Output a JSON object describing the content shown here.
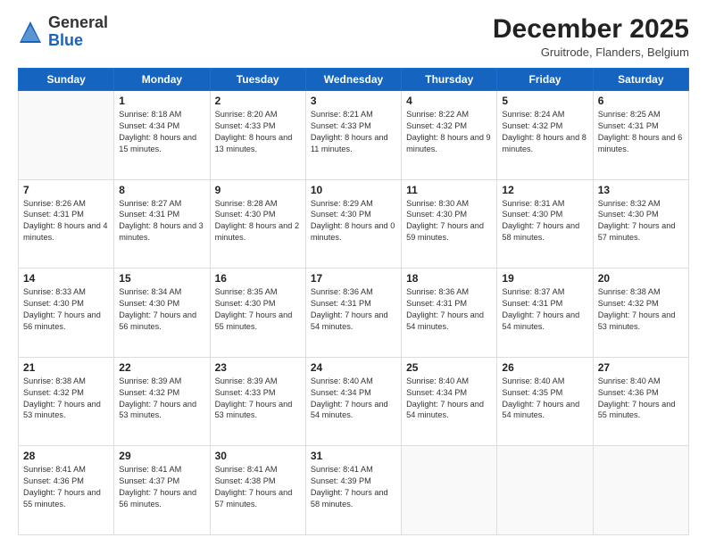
{
  "header": {
    "logo": {
      "general": "General",
      "blue": "Blue"
    },
    "title": "December 2025",
    "location": "Gruitrode, Flanders, Belgium"
  },
  "days_of_week": [
    "Sunday",
    "Monday",
    "Tuesday",
    "Wednesday",
    "Thursday",
    "Friday",
    "Saturday"
  ],
  "weeks": [
    [
      {
        "day": "",
        "info": ""
      },
      {
        "day": "1",
        "info": "Sunrise: 8:18 AM\nSunset: 4:34 PM\nDaylight: 8 hours\nand 15 minutes."
      },
      {
        "day": "2",
        "info": "Sunrise: 8:20 AM\nSunset: 4:33 PM\nDaylight: 8 hours\nand 13 minutes."
      },
      {
        "day": "3",
        "info": "Sunrise: 8:21 AM\nSunset: 4:33 PM\nDaylight: 8 hours\nand 11 minutes."
      },
      {
        "day": "4",
        "info": "Sunrise: 8:22 AM\nSunset: 4:32 PM\nDaylight: 8 hours\nand 9 minutes."
      },
      {
        "day": "5",
        "info": "Sunrise: 8:24 AM\nSunset: 4:32 PM\nDaylight: 8 hours\nand 8 minutes."
      },
      {
        "day": "6",
        "info": "Sunrise: 8:25 AM\nSunset: 4:31 PM\nDaylight: 8 hours\nand 6 minutes."
      }
    ],
    [
      {
        "day": "7",
        "info": "Sunrise: 8:26 AM\nSunset: 4:31 PM\nDaylight: 8 hours\nand 4 minutes."
      },
      {
        "day": "8",
        "info": "Sunrise: 8:27 AM\nSunset: 4:31 PM\nDaylight: 8 hours\nand 3 minutes."
      },
      {
        "day": "9",
        "info": "Sunrise: 8:28 AM\nSunset: 4:30 PM\nDaylight: 8 hours\nand 2 minutes."
      },
      {
        "day": "10",
        "info": "Sunrise: 8:29 AM\nSunset: 4:30 PM\nDaylight: 8 hours\nand 0 minutes."
      },
      {
        "day": "11",
        "info": "Sunrise: 8:30 AM\nSunset: 4:30 PM\nDaylight: 7 hours\nand 59 minutes."
      },
      {
        "day": "12",
        "info": "Sunrise: 8:31 AM\nSunset: 4:30 PM\nDaylight: 7 hours\nand 58 minutes."
      },
      {
        "day": "13",
        "info": "Sunrise: 8:32 AM\nSunset: 4:30 PM\nDaylight: 7 hours\nand 57 minutes."
      }
    ],
    [
      {
        "day": "14",
        "info": "Sunrise: 8:33 AM\nSunset: 4:30 PM\nDaylight: 7 hours\nand 56 minutes."
      },
      {
        "day": "15",
        "info": "Sunrise: 8:34 AM\nSunset: 4:30 PM\nDaylight: 7 hours\nand 56 minutes."
      },
      {
        "day": "16",
        "info": "Sunrise: 8:35 AM\nSunset: 4:30 PM\nDaylight: 7 hours\nand 55 minutes."
      },
      {
        "day": "17",
        "info": "Sunrise: 8:36 AM\nSunset: 4:31 PM\nDaylight: 7 hours\nand 54 minutes."
      },
      {
        "day": "18",
        "info": "Sunrise: 8:36 AM\nSunset: 4:31 PM\nDaylight: 7 hours\nand 54 minutes."
      },
      {
        "day": "19",
        "info": "Sunrise: 8:37 AM\nSunset: 4:31 PM\nDaylight: 7 hours\nand 54 minutes."
      },
      {
        "day": "20",
        "info": "Sunrise: 8:38 AM\nSunset: 4:32 PM\nDaylight: 7 hours\nand 53 minutes."
      }
    ],
    [
      {
        "day": "21",
        "info": "Sunrise: 8:38 AM\nSunset: 4:32 PM\nDaylight: 7 hours\nand 53 minutes."
      },
      {
        "day": "22",
        "info": "Sunrise: 8:39 AM\nSunset: 4:32 PM\nDaylight: 7 hours\nand 53 minutes."
      },
      {
        "day": "23",
        "info": "Sunrise: 8:39 AM\nSunset: 4:33 PM\nDaylight: 7 hours\nand 53 minutes."
      },
      {
        "day": "24",
        "info": "Sunrise: 8:40 AM\nSunset: 4:34 PM\nDaylight: 7 hours\nand 54 minutes."
      },
      {
        "day": "25",
        "info": "Sunrise: 8:40 AM\nSunset: 4:34 PM\nDaylight: 7 hours\nand 54 minutes."
      },
      {
        "day": "26",
        "info": "Sunrise: 8:40 AM\nSunset: 4:35 PM\nDaylight: 7 hours\nand 54 minutes."
      },
      {
        "day": "27",
        "info": "Sunrise: 8:40 AM\nSunset: 4:36 PM\nDaylight: 7 hours\nand 55 minutes."
      }
    ],
    [
      {
        "day": "28",
        "info": "Sunrise: 8:41 AM\nSunset: 4:36 PM\nDaylight: 7 hours\nand 55 minutes."
      },
      {
        "day": "29",
        "info": "Sunrise: 8:41 AM\nSunset: 4:37 PM\nDaylight: 7 hours\nand 56 minutes."
      },
      {
        "day": "30",
        "info": "Sunrise: 8:41 AM\nSunset: 4:38 PM\nDaylight: 7 hours\nand 57 minutes."
      },
      {
        "day": "31",
        "info": "Sunrise: 8:41 AM\nSunset: 4:39 PM\nDaylight: 7 hours\nand 58 minutes."
      },
      {
        "day": "",
        "info": ""
      },
      {
        "day": "",
        "info": ""
      },
      {
        "day": "",
        "info": ""
      }
    ]
  ]
}
